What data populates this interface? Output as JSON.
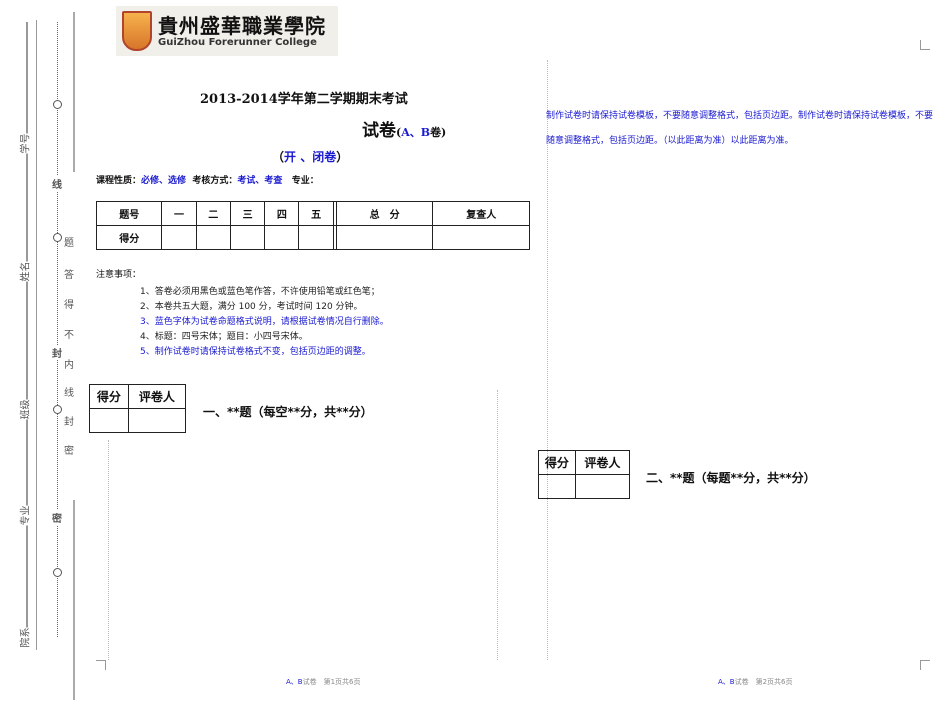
{
  "logo": {
    "name_cn": "貴州盛華職業學院",
    "name_en": "GuiZhou Forerunner College"
  },
  "binding_margin": {
    "fields": [
      "学号",
      "姓名",
      "班级",
      "专业",
      "院系"
    ],
    "seal_marks": [
      "线",
      "封",
      "密"
    ],
    "seal_note": [
      "题",
      "答",
      "得",
      "不",
      "内",
      "线",
      "封",
      "密"
    ]
  },
  "page1": {
    "title": "2013-2014学年第二学期期末考试",
    "subtitle_main": "试卷",
    "subtitle_paren_open": "(",
    "subtitle_ab": "A、B",
    "subtitle_end": "卷)",
    "exam_type_open": "（",
    "exam_type": "开 、闭卷",
    "exam_type_close": "）",
    "info": {
      "course_nature_label": "课程性质：",
      "course_nature_value": "必修、选修",
      "assess_label": "考核方式：",
      "assess_value": "考试、考查",
      "major_label": "专业："
    },
    "score_table": {
      "header": [
        "题号",
        "一",
        "二",
        "三",
        "四",
        "五",
        "",
        "总　分",
        "复查人"
      ],
      "row_label": "得分"
    },
    "notes_title": "注意事项：",
    "notes": [
      {
        "text": "1、答卷必须用黑色或蓝色笔作答，不许使用铅笔或红色笔；",
        "color": "#222222"
      },
      {
        "text": "2、本卷共五大题，满分 100 分，考试时间 120 分钟。",
        "color": "#222222"
      },
      {
        "text": "3、蓝色字体为试卷命题格式说明，请根据试卷情况自行删除。",
        "color": "#1a1ad0"
      },
      {
        "text": "4、标题：四号宋体；题目：小四号宋体。",
        "color": "#222222"
      },
      {
        "text": "5、制作试卷时请保持试卷格式不变，包括页边距的调整。",
        "color": "#1a1ad0"
      }
    ],
    "grader": {
      "score": "得分",
      "grader": "评卷人"
    },
    "section_title": "一、**题（每空**分，共**分）",
    "footer": {
      "ab": "A、B",
      "text": "试卷　第1页共6页"
    }
  },
  "page2": {
    "instruction": "制作试卷时请保持试卷模板，不要随意调整格式，包括页边距。制作试卷时请保持试卷模板，不要随意调整格式，包括页边距。（以此距离为准）以此距离为准。",
    "grader": {
      "score": "得分",
      "grader": "评卷人"
    },
    "section_title": "二、**题（每题**分，共**分）",
    "footer": {
      "ab": "A、B",
      "text": "试卷　第2页共6页"
    }
  },
  "colors": {
    "accent_blue": "#1a1ad0"
  }
}
